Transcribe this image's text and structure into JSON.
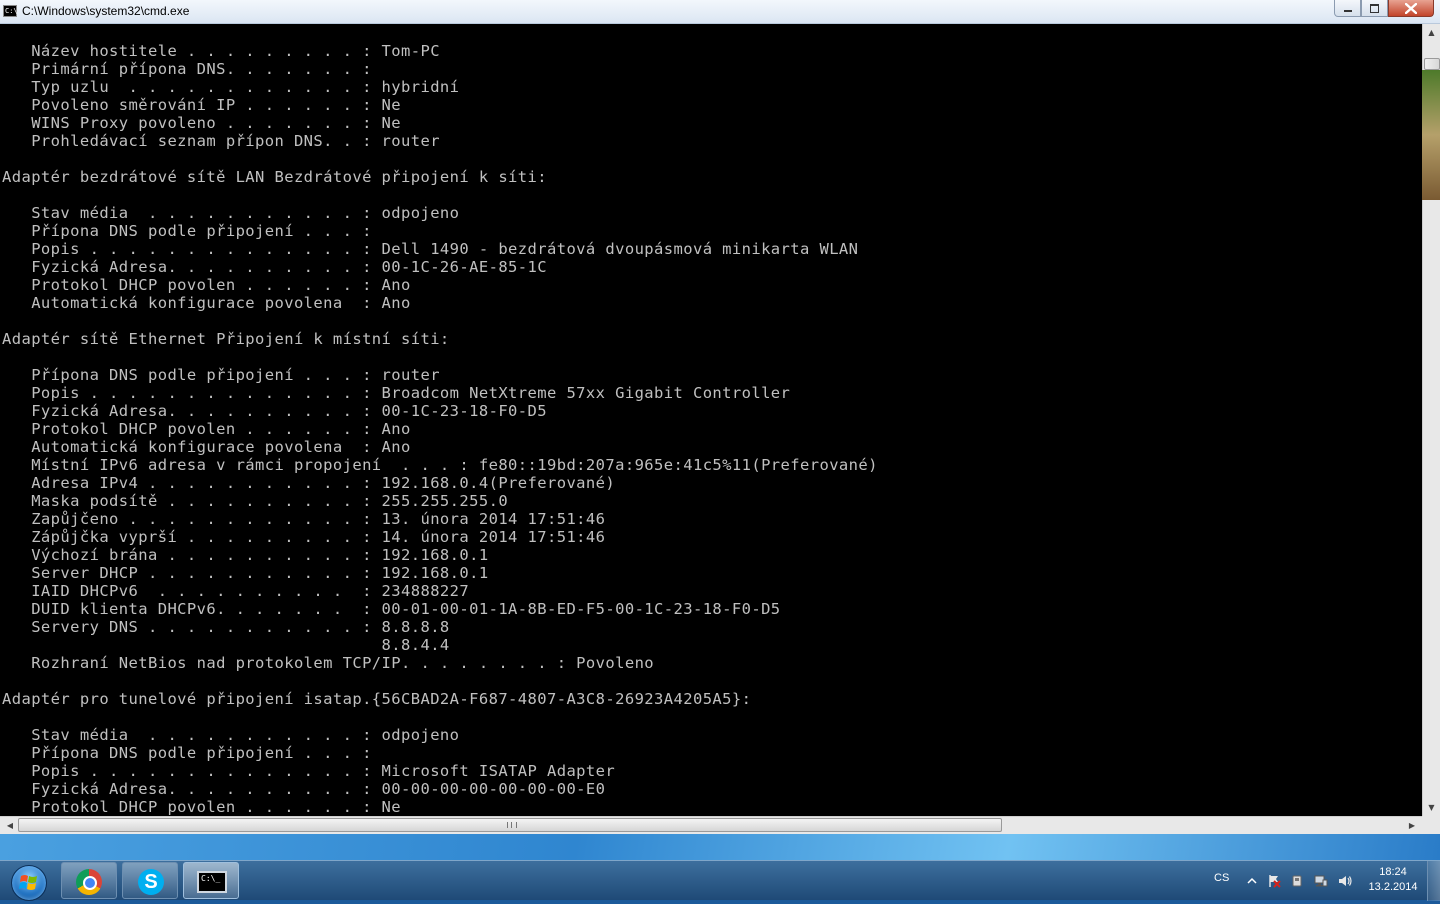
{
  "window": {
    "title": "C:\\Windows\\system32\\cmd.exe",
    "icon_text": "C:\\"
  },
  "console_lines": [
    "   Název hostitele . . . . . . . . . : Tom-PC",
    "   Primární přípona DNS. . . . . . . :",
    "   Typ uzlu  . . . . . . . . . . . . : hybridní",
    "   Povoleno směrování IP . . . . . . : Ne",
    "   WINS Proxy povoleno . . . . . . . : Ne",
    "   Prohledávací seznam přípon DNS. . : router",
    "",
    "Adaptér bezdrátové sítě LAN Bezdrátové připojení k síti:",
    "",
    "   Stav média  . . . . . . . . . . . : odpojeno",
    "   Přípona DNS podle připojení . . . :",
    "   Popis . . . . . . . . . . . . . . : Dell 1490 - bezdrátová dvoupásmová minikarta WLAN",
    "   Fyzická Adresa. . . . . . . . . . : 00-1C-26-AE-85-1C",
    "   Protokol DHCP povolen . . . . . . : Ano",
    "   Automatická konfigurace povolena  : Ano",
    "",
    "Adaptér sítě Ethernet Připojení k místní síti:",
    "",
    "   Přípona DNS podle připojení . . . : router",
    "   Popis . . . . . . . . . . . . . . : Broadcom NetXtreme 57xx Gigabit Controller",
    "   Fyzická Adresa. . . . . . . . . . : 00-1C-23-18-F0-D5",
    "   Protokol DHCP povolen . . . . . . : Ano",
    "   Automatická konfigurace povolena  : Ano",
    "   Místní IPv6 adresa v rámci propojení  . . . : fe80::19bd:207a:965e:41c5%11(Preferované)",
    "   Adresa IPv4 . . . . . . . . . . . : 192.168.0.4(Preferované)",
    "   Maska podsítě . . . . . . . . . . : 255.255.255.0",
    "   Zapůjčeno . . . . . . . . . . . . : 13. února 2014 17:51:46",
    "   Zápůjčka vyprší . . . . . . . . . : 14. února 2014 17:51:46",
    "   Výchozí brána . . . . . . . . . . : 192.168.0.1",
    "   Server DHCP . . . . . . . . . . . : 192.168.0.1",
    "   IAID DHCPv6  . . . . . . . . . .  : 234888227",
    "   DUID klienta DHCPv6. . . . . . .  : 00-01-00-01-1A-8B-ED-F5-00-1C-23-18-F0-D5",
    "   Servery DNS . . . . . . . . . . . : 8.8.8.8",
    "                                       8.8.4.4",
    "   Rozhraní NetBios nad protokolem TCP/IP. . . . . . . . : Povoleno",
    "",
    "Adaptér pro tunelové připojení isatap.{56CBAD2A-F687-4807-A3C8-26923A4205A5}:",
    "",
    "   Stav média  . . . . . . . . . . . : odpojeno",
    "   Přípona DNS podle připojení . . . :",
    "   Popis . . . . . . . . . . . . . . : Microsoft ISATAP Adapter",
    "   Fyzická Adresa. . . . . . . . . . : 00-00-00-00-00-00-00-E0",
    "   Protokol DHCP povolen . . . . . . : Ne"
  ],
  "colors": {
    "console_bg": "#000000",
    "console_fg": "#c0c0c0",
    "close_button": "#c2442a",
    "taskbar": "#1f4a77"
  },
  "taskbar": {
    "start_icon": "windows-start-orb",
    "pinned": [
      {
        "name": "chrome",
        "icon": "chrome-icon"
      },
      {
        "name": "skype",
        "icon": "skype-icon",
        "glyph": "S"
      },
      {
        "name": "cmd",
        "icon": "cmd-icon",
        "glyph": "C:\\_",
        "active": true
      }
    ],
    "tray": {
      "language": "CS",
      "time": "18:24",
      "date": "13.2.2014"
    }
  }
}
